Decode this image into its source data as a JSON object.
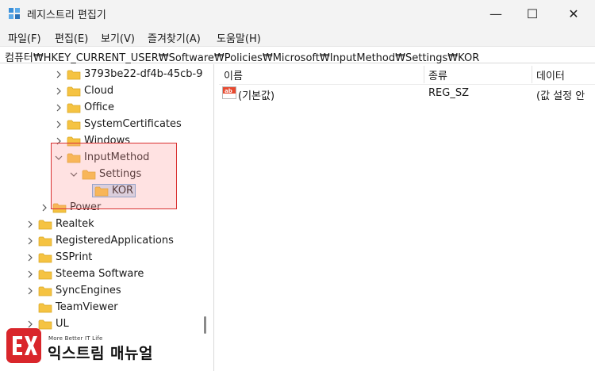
{
  "window": {
    "title": "레지스트리 편집기",
    "minimize_glyph": "—",
    "maximize_glyph": "☐",
    "close_glyph": "✕"
  },
  "menu": [
    {
      "label": "파일(F)"
    },
    {
      "label": "편집(E)"
    },
    {
      "label": "보기(V)"
    },
    {
      "label": "즐겨찾기(A)"
    },
    {
      "label": "도움말(H)"
    }
  ],
  "address": {
    "path": "컴퓨터₩HKEY_CURRENT_USER₩Software₩Policies₩Microsoft₩InputMethod₩Settings₩KOR"
  },
  "tree": [
    {
      "label": "3793be22-df4b-45cb-9",
      "chevron": "right"
    },
    {
      "label": "Cloud",
      "chevron": "right"
    },
    {
      "label": "Office",
      "chevron": "right"
    },
    {
      "label": "SystemCertificates",
      "chevron": "right"
    },
    {
      "label": "Windows",
      "chevron": "right"
    },
    {
      "label": "InputMethod",
      "chevron": "down"
    },
    {
      "label": "Settings",
      "chevron": "down"
    },
    {
      "label": "KOR",
      "chevron": "none",
      "selected": true
    },
    {
      "label": "Power",
      "chevron": "right"
    },
    {
      "label": "Realtek",
      "chevron": "right"
    },
    {
      "label": "RegisteredApplications",
      "chevron": "right"
    },
    {
      "label": "SSPrint",
      "chevron": "right"
    },
    {
      "label": "Steema Software",
      "chevron": "right"
    },
    {
      "label": "SyncEngines",
      "chevron": "right"
    },
    {
      "label": "TeamViewer",
      "chevron": "none"
    },
    {
      "label": "UL",
      "chevron": "right"
    }
  ],
  "list": {
    "columns": [
      "이름",
      "종류",
      "데이터"
    ],
    "rows": [
      {
        "name": "(기본값)",
        "type": "REG_SZ",
        "data": "(값 설정 안"
      }
    ]
  },
  "watermark": {
    "tagline": "More Better IT Life",
    "brand": "익스트림 매뉴얼"
  },
  "colors": {
    "folder": "#f5c342",
    "highlight_border": "#d93030",
    "selection": "#cde4f7",
    "logo": "#d9262b"
  }
}
